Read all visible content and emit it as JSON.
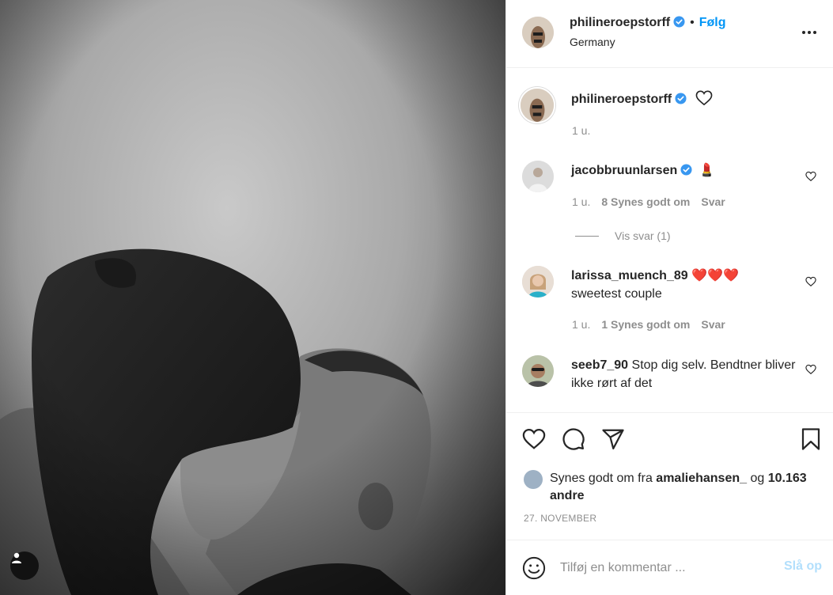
{
  "post": {
    "author": {
      "username": "philineroepstorff",
      "verified": true,
      "location": "Germany",
      "follow_label": "Følg",
      "separator": "•"
    },
    "caption": {
      "username": "philineroepstorff",
      "time": "1 u."
    },
    "comments": [
      {
        "username": "jacobbruunlarsen",
        "verified": true,
        "text": "💄",
        "time": "1 u.",
        "likes": "8 Synes godt om",
        "reply_label": "Svar",
        "view_replies": "Vis svar (1)"
      },
      {
        "username": "larissa_muench_89",
        "verified": false,
        "text": "❤️❤️❤️",
        "text2": "sweetest couple",
        "time": "1 u.",
        "likes": "1 Synes godt om",
        "reply_label": "Svar"
      },
      {
        "username": "seeb7_90",
        "verified": false,
        "text": "Stop dig selv. Bendtner bliver ikke rørt af det"
      }
    ],
    "likes": {
      "prefix": "Synes godt om fra",
      "liker": "amaliehansen_",
      "conjunction": "og",
      "others": "10.163 andre"
    },
    "date": "27. NOVEMBER",
    "comment_input": {
      "placeholder": "Tilføj en kommentar ...",
      "post_label": "Slå op"
    }
  },
  "icons": {
    "verified": "verified-badge-icon",
    "more": "more-options-icon",
    "like": "heart-icon",
    "comment": "comment-icon",
    "share": "share-icon",
    "save": "bookmark-icon",
    "emoji": "emoji-icon",
    "tag": "user-tag-icon"
  },
  "colors": {
    "accent": "#0095f6",
    "verified": "#3897f0",
    "muted": "#8e8e8e",
    "post_disabled": "#b2dffc"
  }
}
